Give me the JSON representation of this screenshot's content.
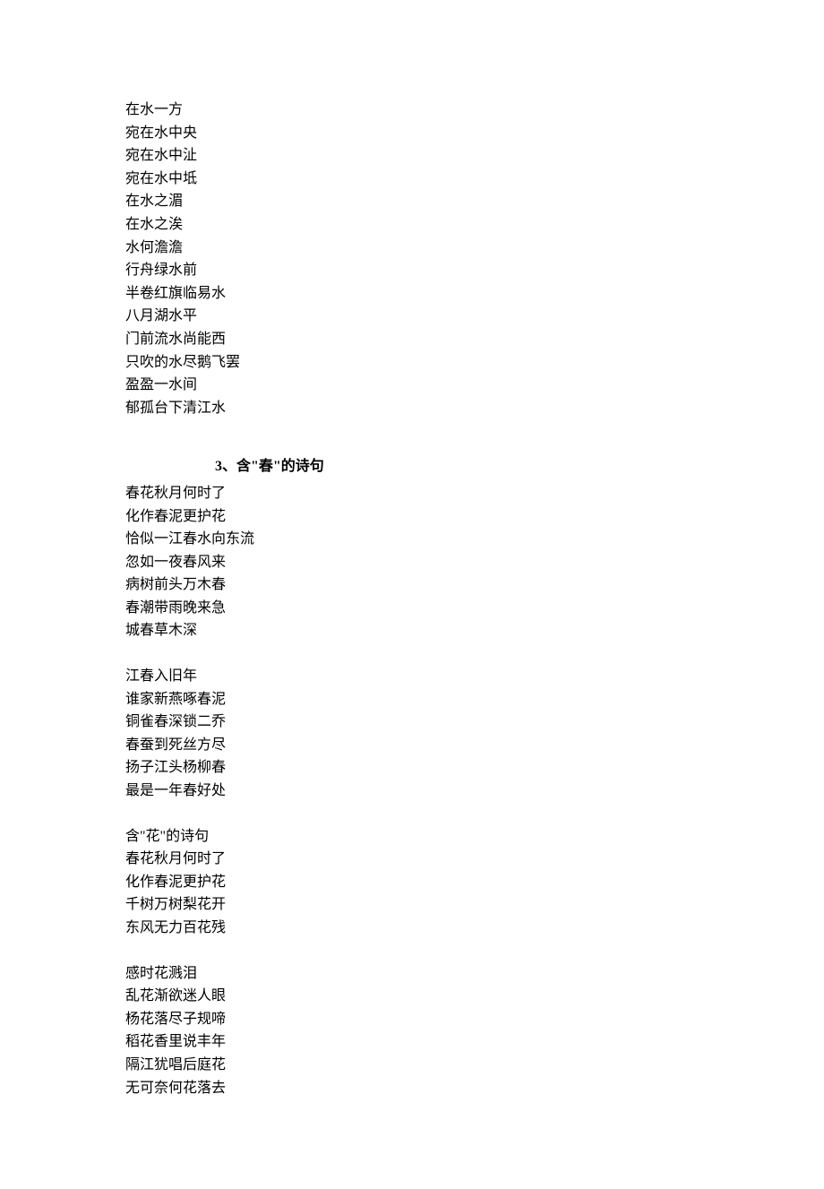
{
  "section1": {
    "lines": [
      "在水一方",
      "宛在水中央",
      "宛在水中沚",
      "宛在水中坻",
      "在水之湄",
      "在水之涘",
      "水何澹澹",
      "行舟绿水前",
      "半卷红旗临易水",
      "八月湖水平",
      "门前流水尚能西",
      "只吹的水尽鹅飞罢",
      "盈盈一水间",
      "郁孤台下清江水"
    ]
  },
  "heading3": "3、含\"春\"的诗句",
  "section2": {
    "group1": [
      "春花秋月何时了",
      "化作春泥更护花",
      "恰似一江春水向东流",
      "忽如一夜春风来",
      "病树前头万木春",
      "春潮带雨晚来急",
      "城春草木深"
    ],
    "group2": [
      "江春入旧年",
      "谁家新燕啄春泥",
      "铜雀春深锁二乔",
      "春蚕到死丝方尽",
      "扬子江头杨柳春",
      "最是一年春好处"
    ],
    "group3": [
      "含\"花\"的诗句",
      "春花秋月何时了",
      "化作春泥更护花",
      "千树万树梨花开",
      "东风无力百花残"
    ],
    "group4": [
      "感时花溅泪",
      "乱花渐欲迷人眼",
      "杨花落尽子规啼",
      "稻花香里说丰年",
      "隔江犹唱后庭花",
      "无可奈何花落去"
    ]
  }
}
